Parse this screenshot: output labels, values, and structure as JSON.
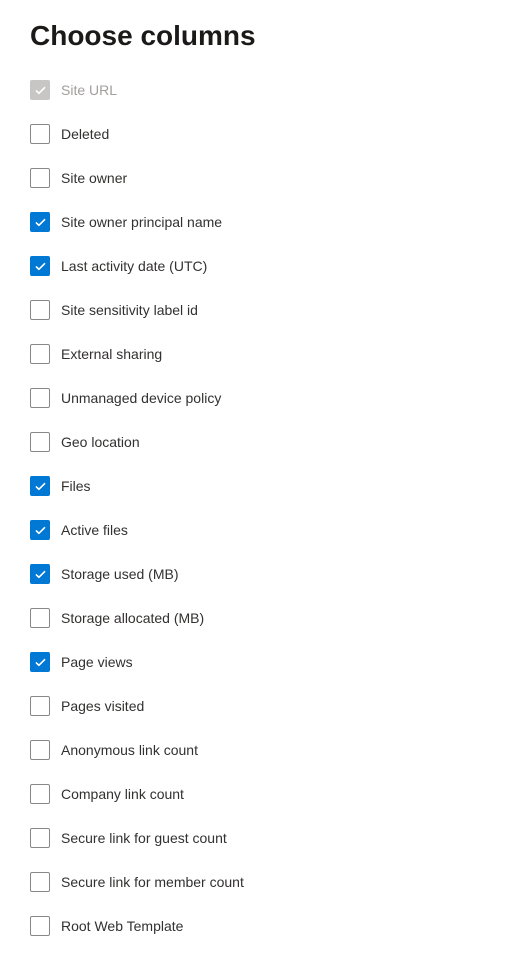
{
  "title": "Choose columns",
  "columns": [
    {
      "id": "site-url",
      "label": "Site URL",
      "checked": true,
      "disabled": true
    },
    {
      "id": "deleted",
      "label": "Deleted",
      "checked": false,
      "disabled": false
    },
    {
      "id": "site-owner",
      "label": "Site owner",
      "checked": false,
      "disabled": false
    },
    {
      "id": "site-owner-principal-name",
      "label": "Site owner principal name",
      "checked": true,
      "disabled": false
    },
    {
      "id": "last-activity-date",
      "label": "Last activity date (UTC)",
      "checked": true,
      "disabled": false
    },
    {
      "id": "site-sensitivity-label-id",
      "label": "Site sensitivity label id",
      "checked": false,
      "disabled": false
    },
    {
      "id": "external-sharing",
      "label": "External sharing",
      "checked": false,
      "disabled": false
    },
    {
      "id": "unmanaged-device-policy",
      "label": "Unmanaged device policy",
      "checked": false,
      "disabled": false
    },
    {
      "id": "geo-location",
      "label": "Geo location",
      "checked": false,
      "disabled": false
    },
    {
      "id": "files",
      "label": "Files",
      "checked": true,
      "disabled": false
    },
    {
      "id": "active-files",
      "label": "Active files",
      "checked": true,
      "disabled": false
    },
    {
      "id": "storage-used",
      "label": "Storage used (MB)",
      "checked": true,
      "disabled": false
    },
    {
      "id": "storage-allocated",
      "label": "Storage allocated (MB)",
      "checked": false,
      "disabled": false
    },
    {
      "id": "page-views",
      "label": "Page views",
      "checked": true,
      "disabled": false
    },
    {
      "id": "pages-visited",
      "label": "Pages visited",
      "checked": false,
      "disabled": false
    },
    {
      "id": "anonymous-link-count",
      "label": "Anonymous link count",
      "checked": false,
      "disabled": false
    },
    {
      "id": "company-link-count",
      "label": "Company link count",
      "checked": false,
      "disabled": false
    },
    {
      "id": "secure-link-guest-count",
      "label": "Secure link for guest count",
      "checked": false,
      "disabled": false
    },
    {
      "id": "secure-link-member-count",
      "label": "Secure link for member count",
      "checked": false,
      "disabled": false
    },
    {
      "id": "root-web-template",
      "label": "Root Web Template",
      "checked": false,
      "disabled": false
    }
  ]
}
